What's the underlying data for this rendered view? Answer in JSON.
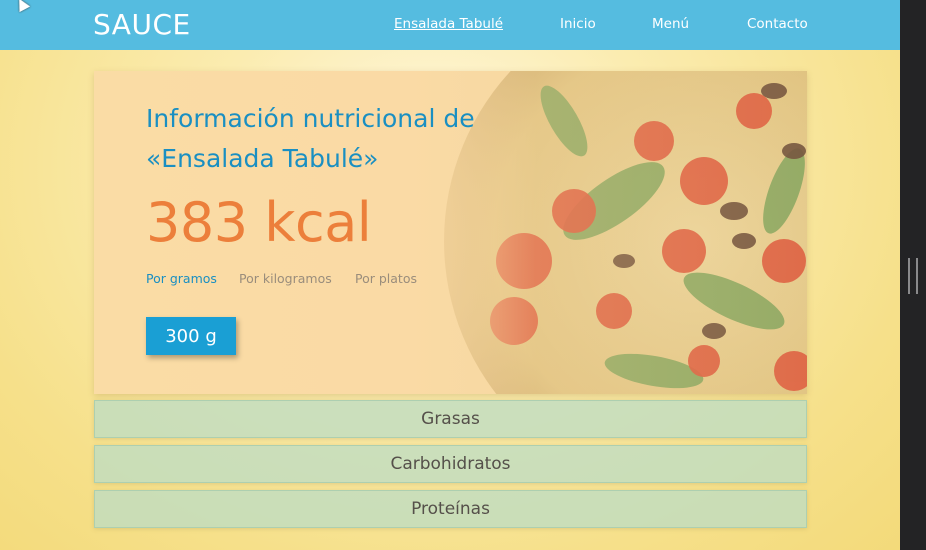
{
  "nav": {
    "brand": "SAUCE",
    "links": [
      {
        "label": "Ensalada Tabulé",
        "active": true
      },
      {
        "label": "Inicio"
      },
      {
        "label": "Menú"
      },
      {
        "label": "Contacto"
      }
    ]
  },
  "hero": {
    "title_line1": "Información nutricional de",
    "title_line2": "«Ensalada Tabulé»",
    "calories": "383 kcal",
    "tabs": [
      "Por gramos",
      "Por kilogramos",
      "Por platos"
    ],
    "active_tab": "Por gramos",
    "amount": "300 g"
  },
  "sections": [
    "Grasas",
    "Carbohidratos",
    "Proteínas"
  ],
  "colors": {
    "navbar": "#55bce0",
    "title": "#1a8fc2",
    "calories": "#ec7f3b",
    "button": "#1a9fd4",
    "section": "#bedcc3"
  },
  "icons": {
    "cursor": "mouse-pointer-icon"
  }
}
